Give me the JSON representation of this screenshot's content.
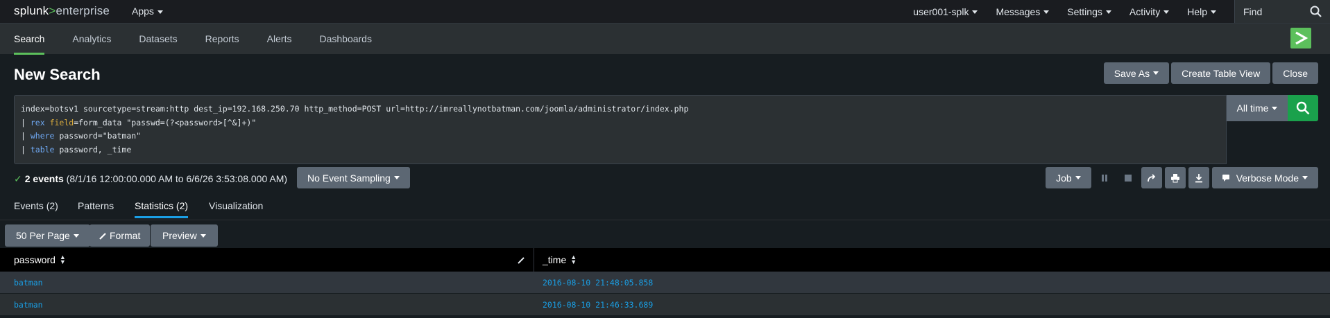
{
  "topbar": {
    "logo_splunk": "splunk",
    "logo_gt": ">",
    "logo_product": "enterprise",
    "apps_label": "Apps",
    "user_label": "user001-splk",
    "messages_label": "Messages",
    "settings_label": "Settings",
    "activity_label": "Activity",
    "help_label": "Help",
    "find_label": "Find"
  },
  "appbar": {
    "items": [
      {
        "label": "Search"
      },
      {
        "label": "Analytics"
      },
      {
        "label": "Datasets"
      },
      {
        "label": "Reports"
      },
      {
        "label": "Alerts"
      },
      {
        "label": "Dashboards"
      }
    ]
  },
  "page": {
    "title": "New Search",
    "save_as_label": "Save As",
    "create_table_label": "Create Table View",
    "close_label": "Close"
  },
  "search": {
    "line1": "index=botsv1 sourcetype=stream:http dest_ip=192.168.250.70 http_method=POST url=http://imreallynotbatman.com/joomla/administrator/index.php",
    "line2_pipe": "| ",
    "line2_cmd": "rex",
    "line2_field": " field",
    "line2_rest": "=form_data \"passwd=(?<password>[^&]+)\"",
    "line3_pipe": "| ",
    "line3_cmd": "where",
    "line3_rest": " password=\"batman\"",
    "line4_pipe": "| ",
    "line4_cmd": "table",
    "line4_rest": " password, _time",
    "time_range": "All time"
  },
  "status": {
    "count": "2 events",
    "range": "(8/1/16 12:00:00.000 AM to 6/6/26 3:53:08.000 AM)",
    "sampling_label": "No Event Sampling",
    "job_label": "Job",
    "mode_label": "Verbose Mode"
  },
  "tabs": [
    {
      "label": "Events (2)"
    },
    {
      "label": "Patterns"
    },
    {
      "label": "Statistics (2)"
    },
    {
      "label": "Visualization"
    }
  ],
  "tablebar": {
    "per_page_label": "50 Per Page",
    "format_label": "Format",
    "preview_label": "Preview"
  },
  "table": {
    "columns": [
      "password",
      "_time"
    ],
    "rows": [
      [
        "batman",
        "2016-08-10 21:48:05.858"
      ],
      [
        "batman",
        "2016-08-10 21:46:33.689"
      ]
    ]
  },
  "colors": {
    "accent_green": "#5cc05c",
    "search_green": "#1aa14c",
    "link_blue": "#1a9fe5",
    "button_gray": "#5c6773"
  }
}
